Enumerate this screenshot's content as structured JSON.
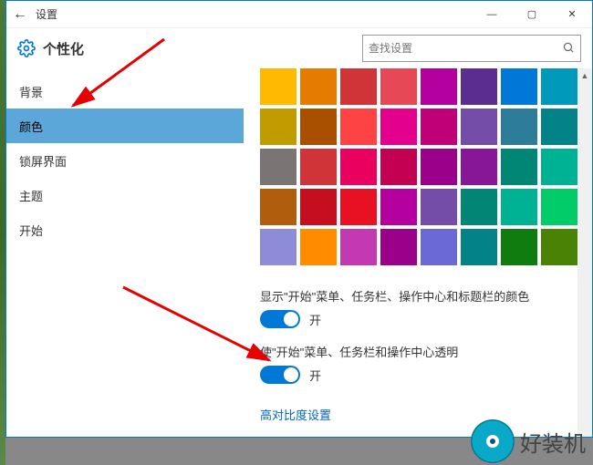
{
  "window": {
    "title": "设置"
  },
  "header": {
    "page_title": "个性化",
    "search_placeholder": "查找设置"
  },
  "sidebar": {
    "items": [
      {
        "label": "背景"
      },
      {
        "label": "颜色"
      },
      {
        "label": "锁屏界面"
      },
      {
        "label": "主题"
      },
      {
        "label": "开始"
      }
    ],
    "selected_index": 1
  },
  "content": {
    "colors": [
      "#ffb900",
      "#e57b00",
      "#d13438",
      "#e74856",
      "#b4009e",
      "#5c2d91",
      "#0078d7",
      "#0099bc",
      "#c19c00",
      "#a94f00",
      "#ff4343",
      "#e3008c",
      "#bf0077",
      "#744da9",
      "#2d7d9a",
      "#038387",
      "#7a7574",
      "#d13438",
      "#ea005e",
      "#c30052",
      "#9a0089",
      "#881798",
      "#018574",
      "#00b294",
      "#b05e0e",
      "#c50f1f",
      "#e81123",
      "#b4009e",
      "#744da9",
      "#018574",
      "#00b294",
      "#00cc6a",
      "#8e8cd8",
      "#ff8c00",
      "#c239b3",
      "#9a0089",
      "#6b69d6",
      "#038387",
      "#107c10",
      "#498205"
    ],
    "toggle1": {
      "label": "显示\"开始\"菜单、任务栏、操作中心和标题栏的颜色",
      "state": "开",
      "on": true
    },
    "toggle2": {
      "label": "使\"开始\"菜单、任务栏和操作中心透明",
      "state": "开",
      "on": true
    },
    "contrast_link": "高对比度设置"
  },
  "watermark": {
    "text": "好装机"
  }
}
